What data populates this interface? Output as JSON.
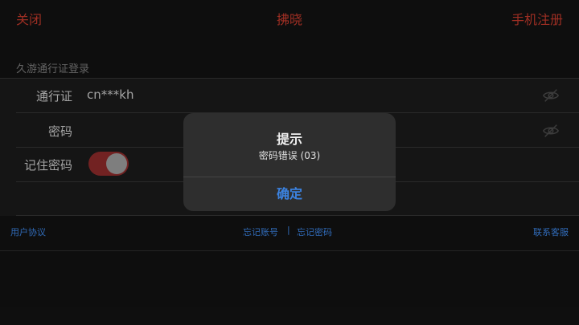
{
  "navbar": {
    "close_label": "关闭",
    "title": "拂晓",
    "phone_register_label": "手机注册"
  },
  "section_header": "久游通行证登录",
  "form": {
    "account": {
      "label": "通行证",
      "value": "cn***kh",
      "icon": "eye-slash-icon"
    },
    "password": {
      "label": "密码",
      "value": "",
      "icon": "eye-slash-icon"
    },
    "remember": {
      "label": "记住密码",
      "enabled": true
    }
  },
  "links": {
    "user_agreement": "用户协议",
    "forgot_account": "忘记账号",
    "separator": "|",
    "forgot_password": "忘记密码",
    "contact_support": "联系客服"
  },
  "alert": {
    "title": "提示",
    "message": "密码错误 (03)",
    "confirm_label": "确定"
  },
  "colors": {
    "accent_red": "#c0392b",
    "link_blue": "#3b82e0",
    "toggle_on": "#8b2a2a"
  }
}
